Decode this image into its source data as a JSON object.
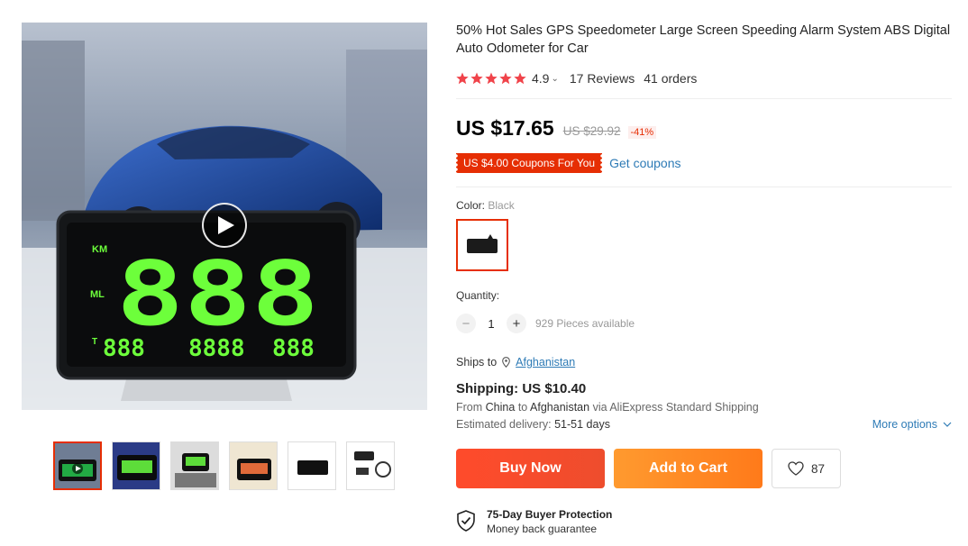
{
  "product": {
    "title": "50% Hot Sales GPS Speedometer Large Screen Speeding Alarm System ABS Digital Auto Odometer for Car",
    "rating": "4.9",
    "reviews": "17 Reviews",
    "orders": "41 orders",
    "price": "US $17.65",
    "original_price": "US $29.92",
    "discount": "-41%",
    "coupon": "US $4.00 Coupons For You",
    "get_coupons": "Get coupons",
    "color_label": "Color:",
    "color_value": "Black",
    "quantity_label": "Quantity:",
    "quantity": "1",
    "qty_minus": "−",
    "qty_plus": "+",
    "available": "929 Pieces available",
    "ships_to_label": "Ships to",
    "ships_to_country": "Afghanistan",
    "shipping_cost": "Shipping: US $10.40",
    "shipping_from_prefix": "From",
    "shipping_from": "China",
    "shipping_to_word": "to",
    "shipping_to": "Afghanistan",
    "shipping_via": "via AliExpress Standard Shipping",
    "delivery_label": "Estimated delivery:",
    "delivery_days": "51-51 days",
    "more_options": "More options",
    "buy_now": "Buy Now",
    "add_to_cart": "Add to Cart",
    "wishlist_count": "87",
    "protection_title": "75-Day Buyer Protection",
    "protection_sub": "Money back guarantee"
  },
  "display_digits": {
    "km_label": "KM",
    "ml_label": "ML",
    "main": "888",
    "t_label": "T",
    "small_left": "888",
    "small_mid": "8888",
    "small_right": "888"
  },
  "colors": {
    "accent": "#e62e04",
    "link": "#2e7bb6",
    "star": "#f0434a",
    "buy": "#ff4b2b",
    "cart": "#ff8c1f",
    "lcd_green": "#6dff3b"
  },
  "icons": {
    "play": "play-icon",
    "pin": "location-pin-icon",
    "chevron": "chevron-down-icon",
    "heart": "heart-icon",
    "shield": "shield-check-icon",
    "star": "star-icon"
  }
}
